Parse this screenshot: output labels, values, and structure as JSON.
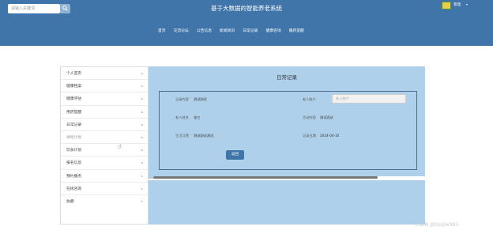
{
  "header": {
    "search_placeholder": "请输入关键词",
    "site_title": "基于大数据的智能养老系统",
    "user_name": "管理",
    "user_caret": "▾"
  },
  "nav": {
    "items": [
      {
        "label": "首页"
      },
      {
        "label": "交流论坛"
      },
      {
        "label": "公告信息"
      },
      {
        "label": "新闻资讯"
      },
      {
        "label": "日常记录"
      },
      {
        "label": "健康咨询"
      },
      {
        "label": "服药提醒"
      }
    ]
  },
  "sidebar": {
    "items": [
      {
        "label": "个人首页",
        "arrow": "▸"
      },
      {
        "label": "健康档案",
        "arrow": "▸"
      },
      {
        "label": "健康评估",
        "arrow": "▸"
      },
      {
        "label": "用药提醒",
        "arrow": "▸"
      },
      {
        "label": "日常记录",
        "arrow": "▸"
      },
      {
        "label": "体检计划",
        "arrow": "▸"
      },
      {
        "label": "饮食计划",
        "arrow": "▸"
      },
      {
        "label": "报名信息",
        "arrow": "▸"
      },
      {
        "label": "预约服务",
        "arrow": "▸"
      },
      {
        "label": "在线咨询",
        "arrow": "▸"
      },
      {
        "label": "收藏",
        "arrow": "▸"
      }
    ]
  },
  "detail": {
    "title": "日常记录",
    "field1_label": "记录内容",
    "field1_value": "测试测试",
    "field2_label": "老人账户",
    "field2_placeholder": "老人账户",
    "field3_label": "老人姓名",
    "field3_value": "张三",
    "field4_label": "活动内容",
    "field4_value": "测试测试",
    "field5_label": "生活习惯",
    "field5_value": "测试测试测试",
    "field6_label": "记录日期",
    "field6_value": "2024-04-10",
    "back_label": "返回"
  },
  "watermark": "CSDN @bysjlw985",
  "colors": {
    "header_bg": "#3f75a8",
    "panel_bg": "#afd0ea",
    "button_bg": "#3f75a8"
  }
}
